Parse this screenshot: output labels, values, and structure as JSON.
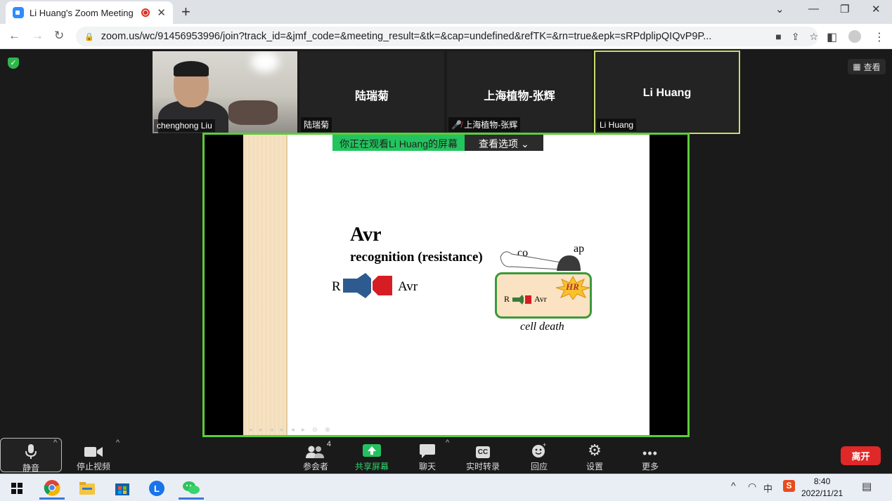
{
  "browser": {
    "tab_title": "Li Huang's Zoom Meeting",
    "url": "zoom.us/wc/91456953996/join?track_id=&jmf_code=&meeting_result=&tk=&cap=undefined&refTK=&rn=true&epk=sRPdplipQIQvP9P..."
  },
  "meeting": {
    "view_label": "查看",
    "participants": [
      {
        "display": "",
        "tag": "chenghong Liu"
      },
      {
        "display": "陆瑞菊",
        "tag": "陆瑞菊"
      },
      {
        "display": "上海植物-张辉",
        "tag": "上海植物-张辉",
        "muted": true
      },
      {
        "display": "Li Huang",
        "tag": "Li Huang",
        "active": true
      }
    ],
    "share_banner": "你正在观看Li Huang的屏幕",
    "view_options": "查看选项"
  },
  "slide": {
    "title": "Avr",
    "subtitle": "recognition  (resistance)",
    "r_label": "R",
    "avr_label": "Avr",
    "co_label": "co",
    "ap_label": "ap",
    "hr_label": "HR",
    "cell_r": "R",
    "cell_avr": "Avr",
    "cell_death": "cell death"
  },
  "toolbar": {
    "mute": "静音",
    "stop_video": "停止视频",
    "participants": "参会者",
    "participant_count": "4",
    "share": "共享屏幕",
    "chat": "聊天",
    "cc_icon": "CC",
    "captions": "实时转录",
    "reactions": "回应",
    "settings": "设置",
    "more": "更多",
    "leave": "离开"
  },
  "taskbar": {
    "time": "8:40",
    "date": "2022/11/21",
    "ime": "中"
  },
  "colors": {
    "share_border": "#5bcc3a",
    "active_speaker": "#ccd971",
    "leave": "#e02828"
  }
}
